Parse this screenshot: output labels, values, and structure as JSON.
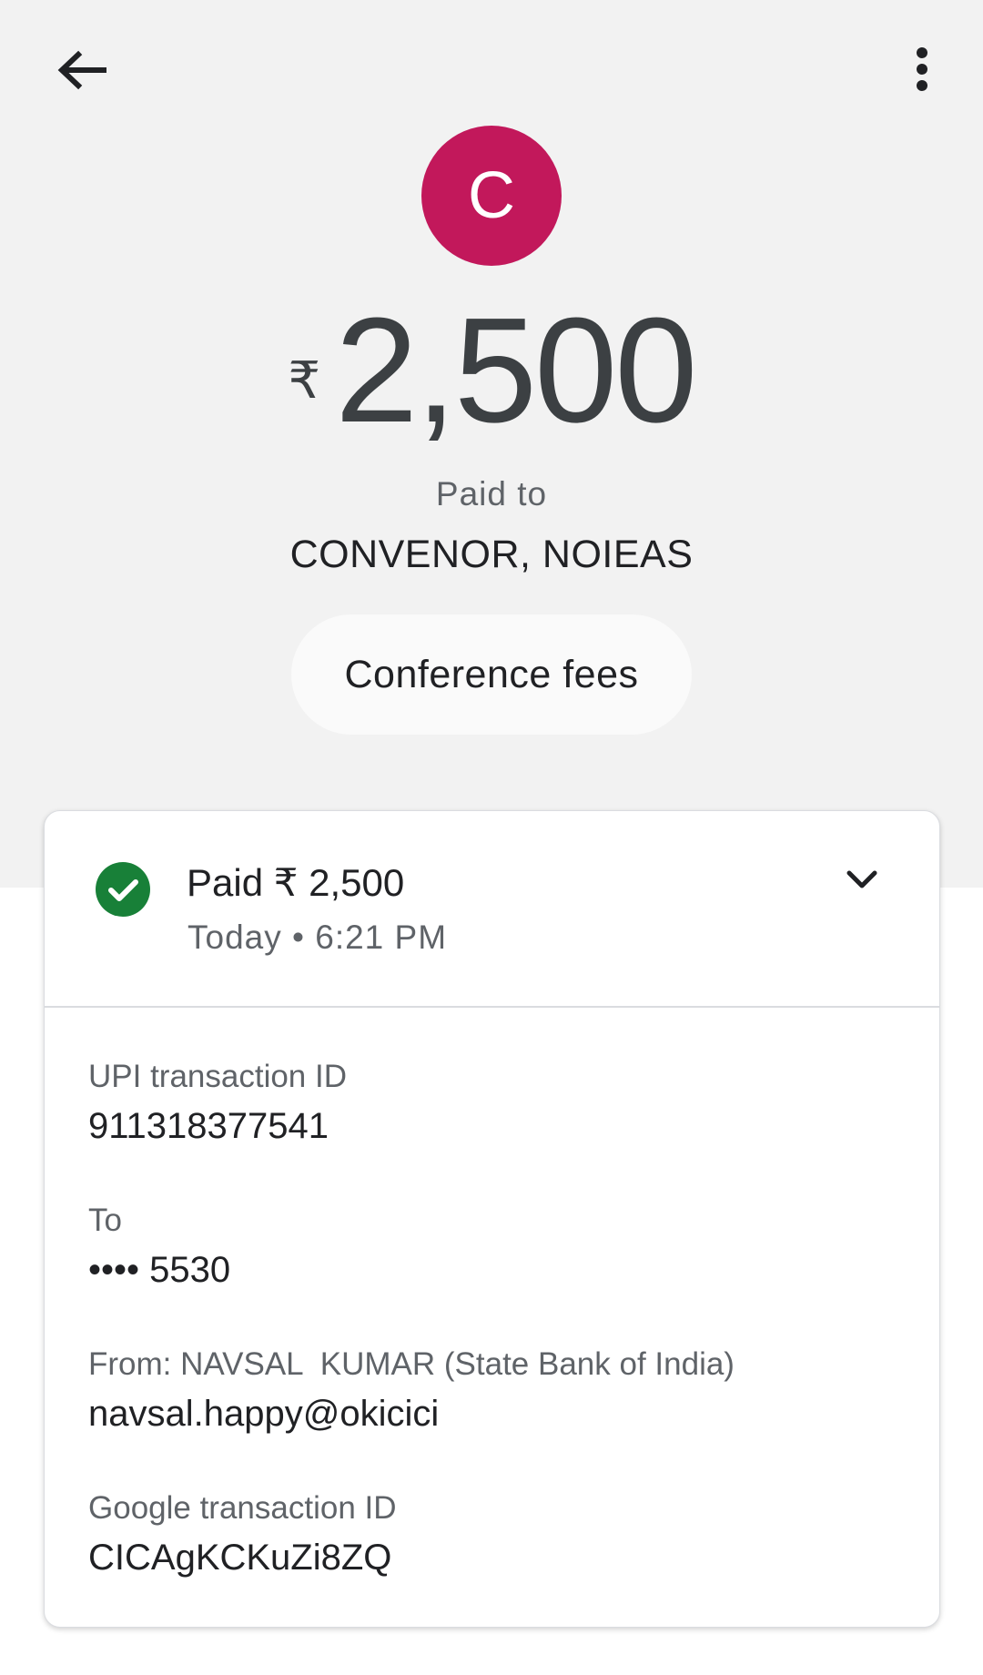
{
  "header": {
    "back_icon": "arrow-back-icon",
    "more_icon": "more-vert-icon"
  },
  "payee": {
    "avatar_letter": "C",
    "avatar_color": "#c2185b",
    "currency_symbol": "₹",
    "amount": "2,500",
    "paid_to_label": "Paid to",
    "name": "CONVENOR, NOIEAS",
    "note": "Conference fees"
  },
  "status": {
    "icon": "check-circle-icon",
    "icon_color": "#188038",
    "title": "Paid ₹ 2,500",
    "time": "Today • 6:21 PM",
    "expand_icon": "chevron-down-icon"
  },
  "details": [
    {
      "label": "UPI transaction ID",
      "value": "911318377541"
    },
    {
      "label": "To",
      "value": "•••• 5530"
    },
    {
      "label": "From: NAVSAL  KUMAR (State Bank of India)",
      "value": "navsal.happy@okicici"
    },
    {
      "label": "Google transaction ID",
      "value": "CICAgKCKuZi8ZQ"
    }
  ]
}
